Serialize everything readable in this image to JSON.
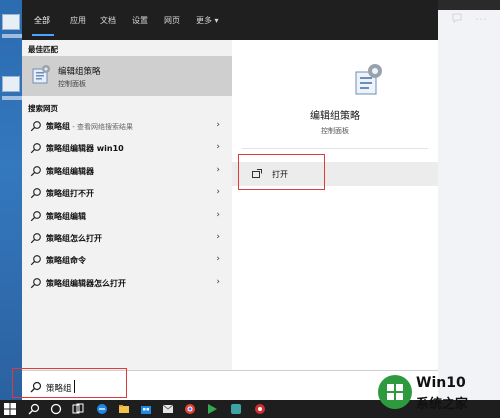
{
  "tabs": [
    "全部",
    "应用",
    "文档",
    "设置",
    "网页",
    "更多 ▾"
  ],
  "sections": {
    "best_match": "最佳匹配",
    "web_search": "搜索网页"
  },
  "best": {
    "title": "编辑组策略",
    "subtitle": "控制面板"
  },
  "web_results": [
    {
      "label": "策略组",
      "suffix": " - 查看网络搜索结果"
    },
    {
      "label": "策略组编辑器 win10",
      "suffix": ""
    },
    {
      "label": "策略组编辑器",
      "suffix": ""
    },
    {
      "label": "策略组打不开",
      "suffix": ""
    },
    {
      "label": "策略组编辑",
      "suffix": ""
    },
    {
      "label": "策略组怎么打开",
      "suffix": ""
    },
    {
      "label": "策略组命令",
      "suffix": ""
    },
    {
      "label": "策略组编辑器怎么打开",
      "suffix": ""
    }
  ],
  "detail": {
    "title": "编辑组策略",
    "subtitle": "控制面板",
    "open_label": "打开"
  },
  "search": {
    "value": "策略组"
  },
  "watermark": {
    "line1": "Win10",
    "line2": "系统之家"
  },
  "colors": {
    "accent": "#4aa3ff",
    "highlight_box": "#e03a3a",
    "topbar": "#1f1f1f",
    "selected_row": "#cfcfcf"
  }
}
